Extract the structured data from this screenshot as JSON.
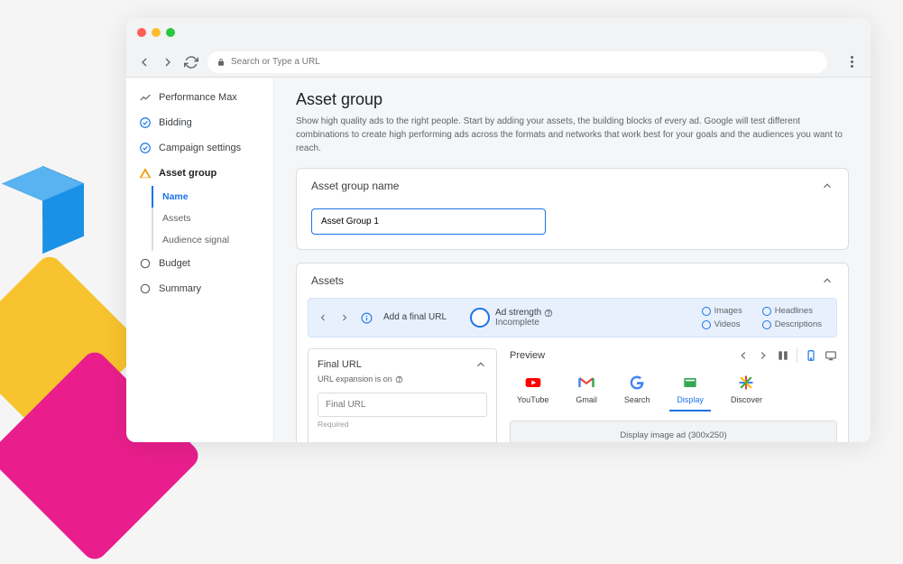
{
  "url_placeholder": "Search or Type a URL",
  "sidebar": {
    "items": [
      {
        "label": "Performance Max"
      },
      {
        "label": "Bidding"
      },
      {
        "label": "Campaign settings"
      },
      {
        "label": "Asset group"
      },
      {
        "label": "Budget"
      },
      {
        "label": "Summary"
      }
    ],
    "sub": [
      {
        "label": "Name"
      },
      {
        "label": "Assets"
      },
      {
        "label": "Audience signal"
      }
    ]
  },
  "main": {
    "title": "Asset group",
    "desc": "Show high quality ads to the right people. Start by adding your assets, the building blocks of every ad. Google will test different combinations to create high performing ads across the formats and networks that work best for your goals and the audiences you want to reach."
  },
  "card1": {
    "title": "Asset group name",
    "value": "Asset Group 1"
  },
  "card2": {
    "title": "Assets",
    "add_url": "Add a final URL",
    "ad_strength_label": "Ad strength",
    "ad_strength_status": "Incomplete",
    "opts": {
      "images": "Images",
      "videos": "Videos",
      "headlines": "Headlines",
      "descriptions": "Descriptions"
    }
  },
  "final": {
    "title": "Final URL",
    "sub": "URL expansion is on",
    "placeholder": "Final URL",
    "req": "Required"
  },
  "preview": {
    "title": "Preview",
    "networks": [
      "YouTube",
      "Gmail",
      "Search",
      "Display",
      "Discover"
    ],
    "ad_label": "Display image ad (300x250)"
  }
}
